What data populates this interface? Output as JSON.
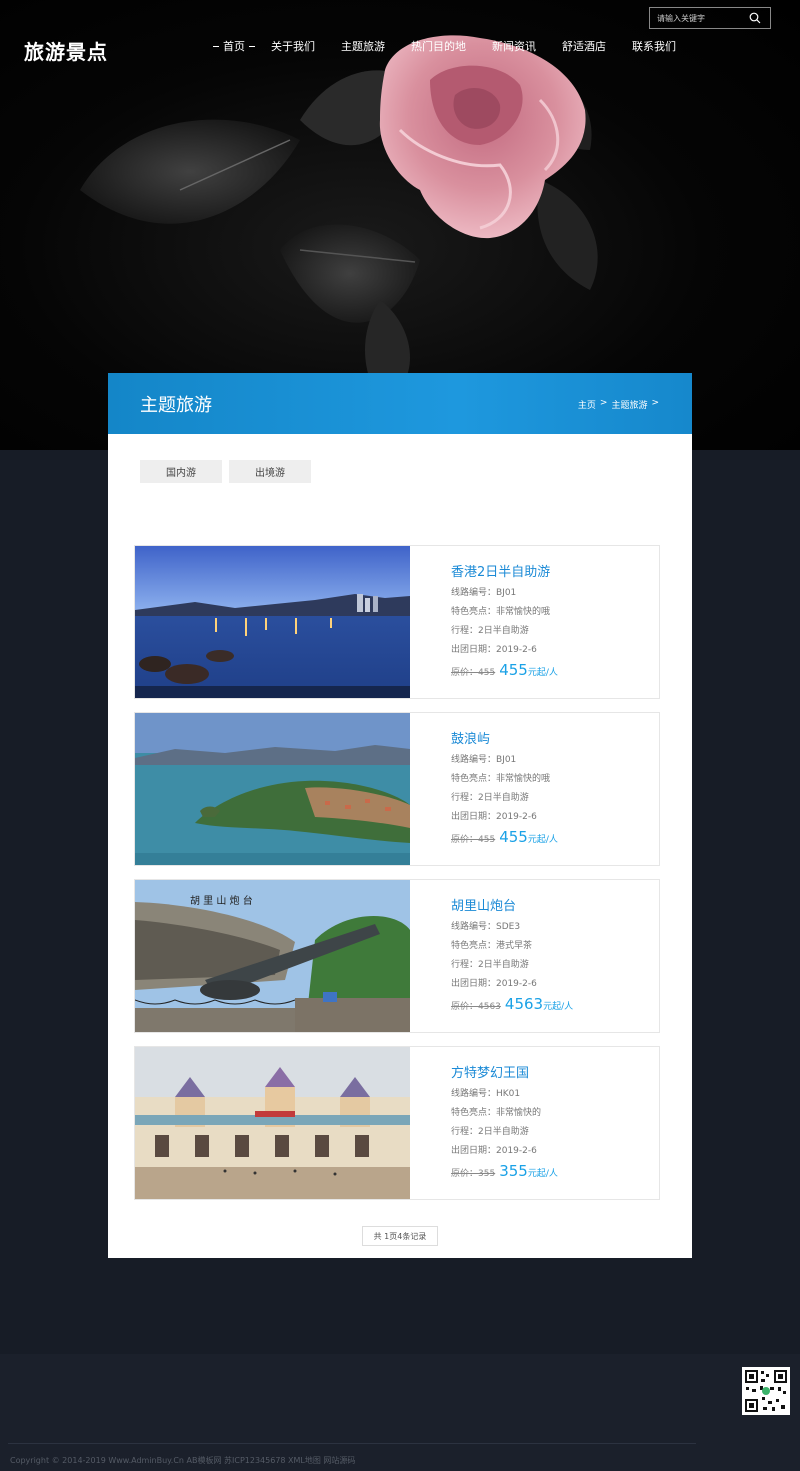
{
  "header": {
    "logo": "旅游景点",
    "nav": [
      "首页",
      "关于我们",
      "主题旅游",
      "热门目的地",
      "新闻资讯",
      "舒适酒店",
      "联系我们"
    ],
    "search_placeholder": "请输入关键字"
  },
  "panel": {
    "title": "主题旅游",
    "breadcrumb": [
      "主页",
      ">",
      "主题旅游",
      ">"
    ],
    "tabs": [
      "国内游",
      "出境游"
    ]
  },
  "tours": [
    {
      "title": "香港2日半自助游",
      "code": "线路编号：BJ01",
      "highlight": "特色亮点：非常愉快的哦",
      "trip": "行程：2日半自助游",
      "date": "出团日期：2019-2-6",
      "orig": "原价：455",
      "price": "455",
      "unit": "元起/人"
    },
    {
      "title": "鼓浪屿",
      "code": "线路编号：BJ01",
      "highlight": "特色亮点：非常愉快的哦",
      "trip": "行程：2日半自助游",
      "date": "出团日期：2019-2-6",
      "orig": "原价：455",
      "price": "455",
      "unit": "元起/人"
    },
    {
      "title": "胡里山炮台",
      "code": "线路编号：SDE3",
      "highlight": "特色亮点：港式早茶",
      "trip": "行程：2日半自助游",
      "date": "出团日期：2019-2-6",
      "orig": "原价：4563",
      "price": "4563",
      "unit": "元起/人"
    },
    {
      "title": "方特梦幻王国",
      "code": "线路编号：HK01",
      "highlight": "特色亮点：非常愉快的",
      "trip": "行程：2日半自助游",
      "date": "出团日期：2019-2-6",
      "orig": "原价：355",
      "price": "355",
      "unit": "元起/人"
    }
  ],
  "pager": "共 1页4条记录",
  "footer": {
    "copyright": "Copyright © 2014-2019 Www.AdminBuy.Cn AB模板网 苏ICP12345678 XML地图 网站源码"
  },
  "colors": {
    "accent": "#1aa1e6",
    "header_bar": "#1486c8",
    "footer_bg": "#1b202b"
  }
}
